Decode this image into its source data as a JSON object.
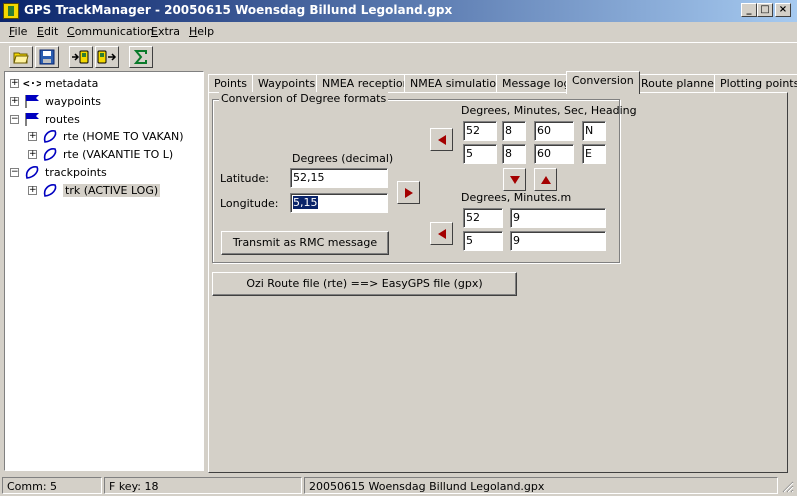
{
  "window": {
    "title": "GPS TrackManager - 20050615 Woensdag Billund Legoland.gpx",
    "controls": {
      "minimize": "_",
      "maximize": "□",
      "close": "×"
    }
  },
  "menu": {
    "items": [
      {
        "key": "F",
        "rest": "ile"
      },
      {
        "key": "E",
        "rest": "dit"
      },
      {
        "key": "C",
        "rest": "ommunication"
      },
      {
        "key": "E",
        "rest": "xtra"
      },
      {
        "key": "H",
        "rest": "elp"
      }
    ]
  },
  "toolbar": {
    "buttons": [
      "open-folder-icon",
      "save-disk-icon",
      "upload-to-device-icon",
      "download-from-device-icon",
      "sigma-icon"
    ]
  },
  "tree": {
    "nodes": [
      {
        "label": "metadata",
        "icon": "metadata-icon",
        "expander": "+"
      },
      {
        "label": "waypoints",
        "icon": "flag-icon",
        "expander": "+"
      },
      {
        "label": "routes",
        "icon": "flag-icon",
        "expander": "−"
      },
      {
        "label": "rte (HOME TO VAKAN)",
        "icon": "route-icon",
        "expander": "+"
      },
      {
        "label": "rte (VAKANTIE TO L)",
        "icon": "route-icon",
        "expander": "+"
      },
      {
        "label": "trackpoints",
        "icon": "track-icon",
        "expander": "−"
      },
      {
        "label": "trk (ACTIVE LOG)",
        "icon": "track-icon",
        "expander": "+"
      }
    ]
  },
  "tabs": [
    "Points",
    "Waypoints",
    "NMEA reception",
    "NMEA simulation",
    "Message log",
    "Conversion",
    "Route planner",
    "Plotting points"
  ],
  "active_tab": "Conversion",
  "conversion": {
    "group_title": "Conversion of Degree formats",
    "dms_header": "Degrees, Minutes, Sec, Heading",
    "dms_lat": {
      "deg": "52",
      "min": "8",
      "sec": "60",
      "heading": "N"
    },
    "dms_lon": {
      "deg": "5",
      "min": "8",
      "sec": "60",
      "heading": "E"
    },
    "decimal_header": "Degrees (decimal)",
    "latitude_label": "Latitude:",
    "longitude_label": "Longitude:",
    "latitude_value": "52,15",
    "longitude_value": "5,15",
    "dm_header": "Degrees, Minutes.m",
    "dm_lat": {
      "deg": "52",
      "min": "9"
    },
    "dm_lon": {
      "deg": "5",
      "min": "9"
    },
    "transmit_button": "Transmit as RMC message",
    "ozi_button": "Ozi Route file (rte) ==> EasyGPS file (gpx)"
  },
  "status": {
    "comm": "Comm: 5",
    "fkey": "F key: 18",
    "file": "20050615 Woensdag Billund Legoland.gpx"
  },
  "colors": {
    "titlebar_start": "#0a246a",
    "titlebar_end": "#a6caf0",
    "arrow": "#a40000",
    "selection": "#0a246a"
  }
}
